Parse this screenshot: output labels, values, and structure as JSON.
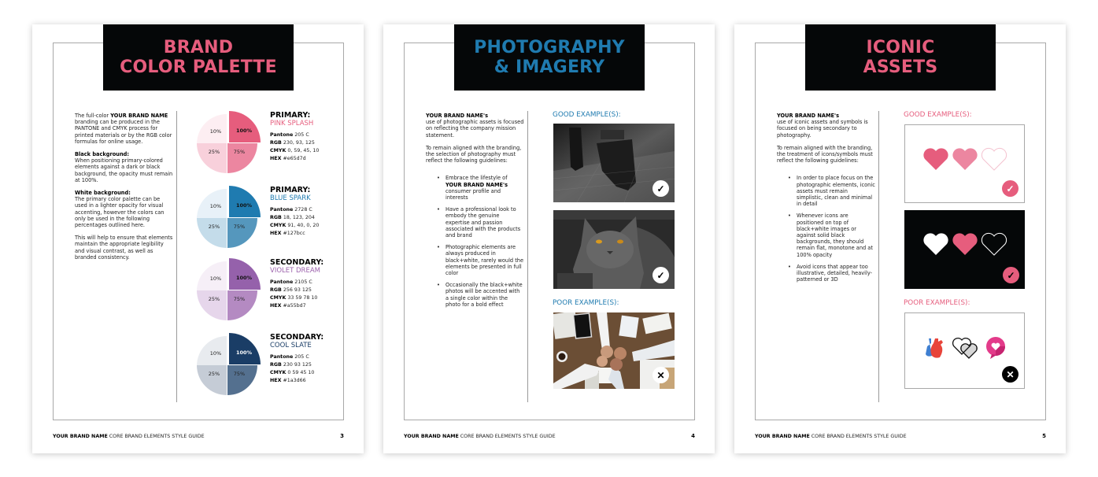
{
  "footer": {
    "brand": "YOUR BRAND NAME",
    "guide_title": "CORE BRAND ELEMENTS STYLE GUIDE"
  },
  "pages": [
    {
      "number": "3",
      "title_line1": "BRAND",
      "title_line2": "COLOR PALETTE",
      "intro": {
        "pre": "The full-color ",
        "brand": "YOUR BRAND NAME",
        "post": " branding can be produced in the PANTONE and CMYK process for printed materials or by the RGB color formulas for online usage."
      },
      "black_bg": {
        "heading": "Black background:",
        "text": "When positioning primary-colored elements against a dark or black background, the opacity must remain at 100%."
      },
      "white_bg": {
        "heading": "White background:",
        "text": "The primary color palette can be used in a lighter opacity for visual accenting, however the colors can only be used in the following percentages outlined here."
      },
      "closing": "This will help to ensure that elements maintain the appropriate legibility and visual contrast, as well as branded consistency.",
      "swatches": [
        {
          "kind": "PRIMARY:",
          "name": "PINK SPLASH",
          "color": "#e65d7d",
          "tints": [
            "#fdeef2",
            "#e65d7d",
            "#f8d0db",
            "#ec86a0"
          ],
          "pantone": "205 C",
          "rgb": "230, 93, 125",
          "cmyk": "0, 59, 45, 10",
          "hex": "#e65d7d"
        },
        {
          "kind": "PRIMARY:",
          "name": "BLUE SPARK",
          "color": "#1f7bb0",
          "tints": [
            "#e8f1f8",
            "#1f7bb0",
            "#c4dcea",
            "#5597bd"
          ],
          "pantone": "2728 C",
          "rgb": "18, 123, 204",
          "cmyk": "91, 40, 0, 20",
          "hex": "#127bcc"
        },
        {
          "kind": "SECONDARY:",
          "name": "VIOLET DREAM",
          "color": "#9d63ad",
          "tints": [
            "#f6eff7",
            "#9561ab",
            "#e6d6eb",
            "#b48ac2"
          ],
          "pantone": "2105 C",
          "rgb": "256 93 125",
          "cmyk": "33 59 78 10",
          "hex": "#a55bd7"
        },
        {
          "kind": "SECONDARY:",
          "name": "COOL SLATE",
          "color": "#1a3d66",
          "tints": [
            "#e8ebef",
            "#1a3d66",
            "#c5ccd6",
            "#54708f"
          ],
          "pantone": "205 C",
          "rgb": "230 93 125",
          "cmyk": "0 59 45 10",
          "hex": "#1a3d66"
        }
      ],
      "tint_labels": [
        "10%",
        "100%",
        "25%",
        "75%"
      ],
      "spec_labels": {
        "pantone": "Pantone",
        "rgb": "RGB",
        "cmyk": "CMYK",
        "hex": "HEX"
      }
    },
    {
      "number": "4",
      "title_line1": "PHOTOGRAPHY",
      "title_line2": "& IMAGERY",
      "intro_brand": "YOUR BRAND NAME's",
      "intro_text": "use of photographic assets is focused on reflecting the company mission statement.",
      "guidelines_intro": "To remain aligned with the branding, the selection of photography must reflect the following guidelines:",
      "bullets": [
        {
          "pre": "Embrace the lifestyle of ",
          "brand": "YOUR BRAND NAME's",
          "post": " consumer profile and interests"
        },
        {
          "pre": "Have a professional look to embody the genuine expertise and passion associated with the products and brand",
          "brand": "",
          "post": ""
        },
        {
          "pre": "Photographic elements are always produced in black+white, rarely would the elements be presented in full color",
          "brand": "",
          "post": ""
        },
        {
          "pre": "Occasionally the black+white photos will be accented with a single color within the photo for a bold effect",
          "brand": "",
          "post": ""
        }
      ],
      "good_label": "GOOD EXAMPLE(S):",
      "poor_label": "POOR EXAMPLE(S):",
      "images": [
        {
          "name": "puddle-reflection-photo",
          "status": "check-icon"
        },
        {
          "name": "grey-cat-photo",
          "status": "check-icon"
        },
        {
          "name": "fist-bump-color-photo",
          "status": "x-icon"
        }
      ]
    },
    {
      "number": "5",
      "title_line1": "ICONIC",
      "title_line2": "ASSETS",
      "intro_brand": "YOUR BRAND NAME's",
      "intro_text": "use of iconic assets and symbols is focused on being secondary to photography.",
      "guidelines_intro": "To remain aligned with the branding, the treatment of icons/symbols must reflect the following guidelines:",
      "bullets": [
        "In order to place focus on the photographic elements, iconic assets must remain simplistic, clean and minimal in detail",
        "Whenever icons are positioned on top of black+white images or against solid black backgrounds, they should remain flat, monotone and at 100% opacity",
        "Avoid icons that appear too illustrative, detailed, heavily-patterned or 3D"
      ],
      "good_label": "GOOD EXAMPLE(S):",
      "poor_label": "POOR EXAMPLE(S):",
      "badges": {
        "check": "✓",
        "x": "✕"
      }
    }
  ],
  "colors": {
    "pink": "#e65d7d",
    "blue": "#1f7bb0",
    "title_bg": "#050708"
  }
}
